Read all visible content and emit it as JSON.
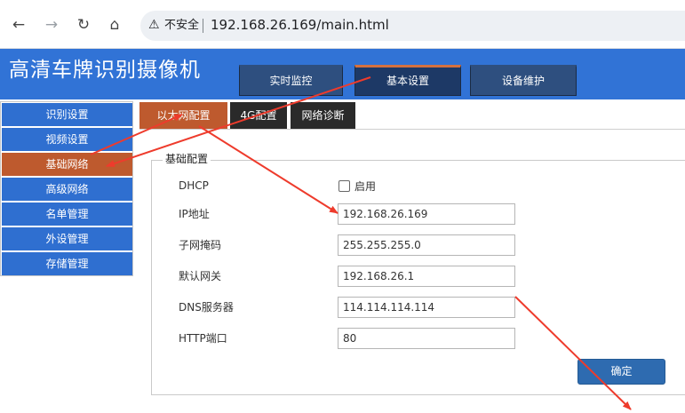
{
  "browser": {
    "back_icon": "arrow-left-icon",
    "forward_icon": "arrow-right-icon",
    "reload_icon": "reload-icon",
    "home_icon": "home-icon",
    "security_warning": "不安全",
    "url": "192.168.26.169/main.html"
  },
  "app": {
    "title": "高清车牌识别摄像机",
    "top_tabs": [
      {
        "label": "实时监控",
        "active": false
      },
      {
        "label": "基本设置",
        "active": true
      },
      {
        "label": "设备维护",
        "active": false
      }
    ]
  },
  "sidebar": {
    "items": [
      {
        "label": "识别设置",
        "active": false
      },
      {
        "label": "视频设置",
        "active": false
      },
      {
        "label": "基础网络",
        "active": true
      },
      {
        "label": "高级网络",
        "active": false
      },
      {
        "label": "名单管理",
        "active": false
      },
      {
        "label": "外设管理",
        "active": false
      },
      {
        "label": "存储管理",
        "active": false
      }
    ]
  },
  "content_tabs": [
    {
      "label": "以太网配置",
      "active": true
    },
    {
      "label": "4G配置",
      "active": false
    },
    {
      "label": "网络诊断",
      "active": false
    }
  ],
  "form": {
    "section_title": "基础配置",
    "dhcp": {
      "label": "DHCP",
      "checkbox_label": "启用",
      "checked": false
    },
    "ip": {
      "label": "IP地址",
      "value": "192.168.26.169"
    },
    "netmask": {
      "label": "子网掩码",
      "value": "255.255.255.0"
    },
    "gateway": {
      "label": "默认网关",
      "value": "192.168.26.1"
    },
    "dns": {
      "label": "DNS服务器",
      "value": "114.114.114.114"
    },
    "http_port": {
      "label": "HTTP端口",
      "value": "80"
    },
    "confirm_label": "确定"
  },
  "colors": {
    "header_blue": "#3173d6",
    "active_orange": "#be5a2e",
    "annotation_red": "#ee3b2c"
  }
}
